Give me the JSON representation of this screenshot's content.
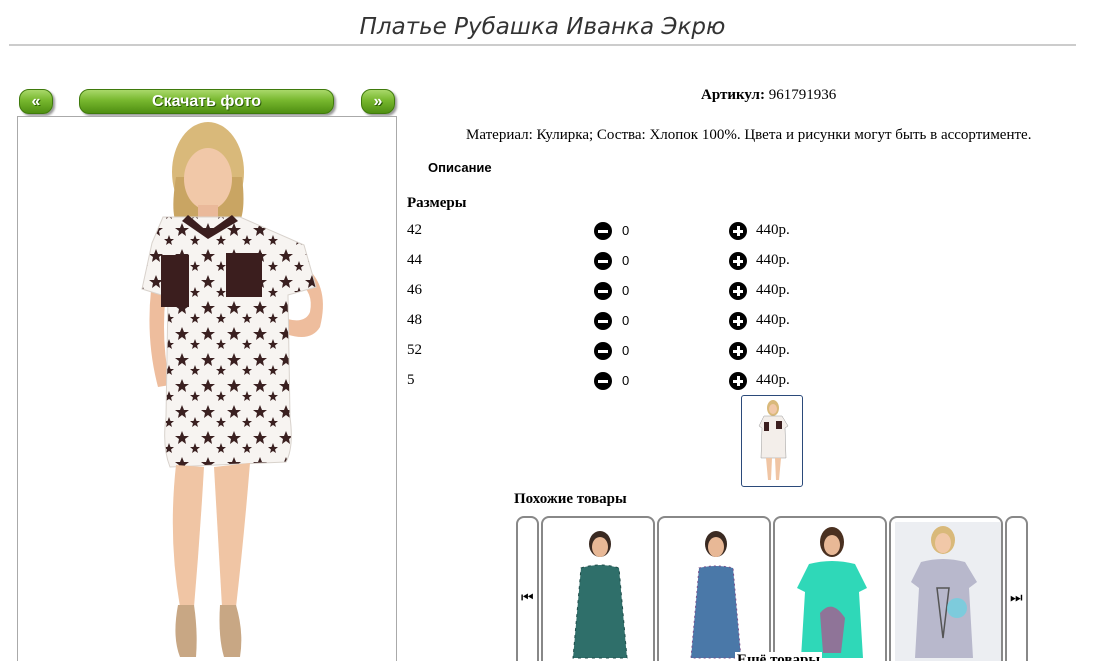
{
  "page": {
    "title": "Платье Рубашка Иванка Экрю"
  },
  "gallery": {
    "prev_label": "«",
    "download_label": "Скачать фото",
    "next_label": "»"
  },
  "product": {
    "article_label": "Артикул:",
    "article_value": "961791936",
    "description": "Материал: Кулирка; Соства: Хлопок 100%. Цвета и рисунки могут быть в ассортименте.",
    "description_tab": "Описание",
    "sizes_heading": "Размеры",
    "sizes": [
      {
        "size": "42",
        "qty": "0",
        "price": "440р."
      },
      {
        "size": "44",
        "qty": "0",
        "price": "440р."
      },
      {
        "size": "46",
        "qty": "0",
        "price": "440р."
      },
      {
        "size": "48",
        "qty": "0",
        "price": "440р."
      },
      {
        "size": "52",
        "qty": "0",
        "price": "440р."
      },
      {
        "size": "5",
        "qty": "0",
        "price": "440р."
      }
    ]
  },
  "similar": {
    "heading": "Похожие товары",
    "prev_icon": "skip-previous-icon",
    "next_icon": "skip-next-icon",
    "prev_glyph": "⏮",
    "next_glyph": "⏭",
    "more_label": "Ещё товары"
  },
  "colors": {
    "button_green": "#77b72e",
    "thumb_border": "#2b4a7a"
  }
}
